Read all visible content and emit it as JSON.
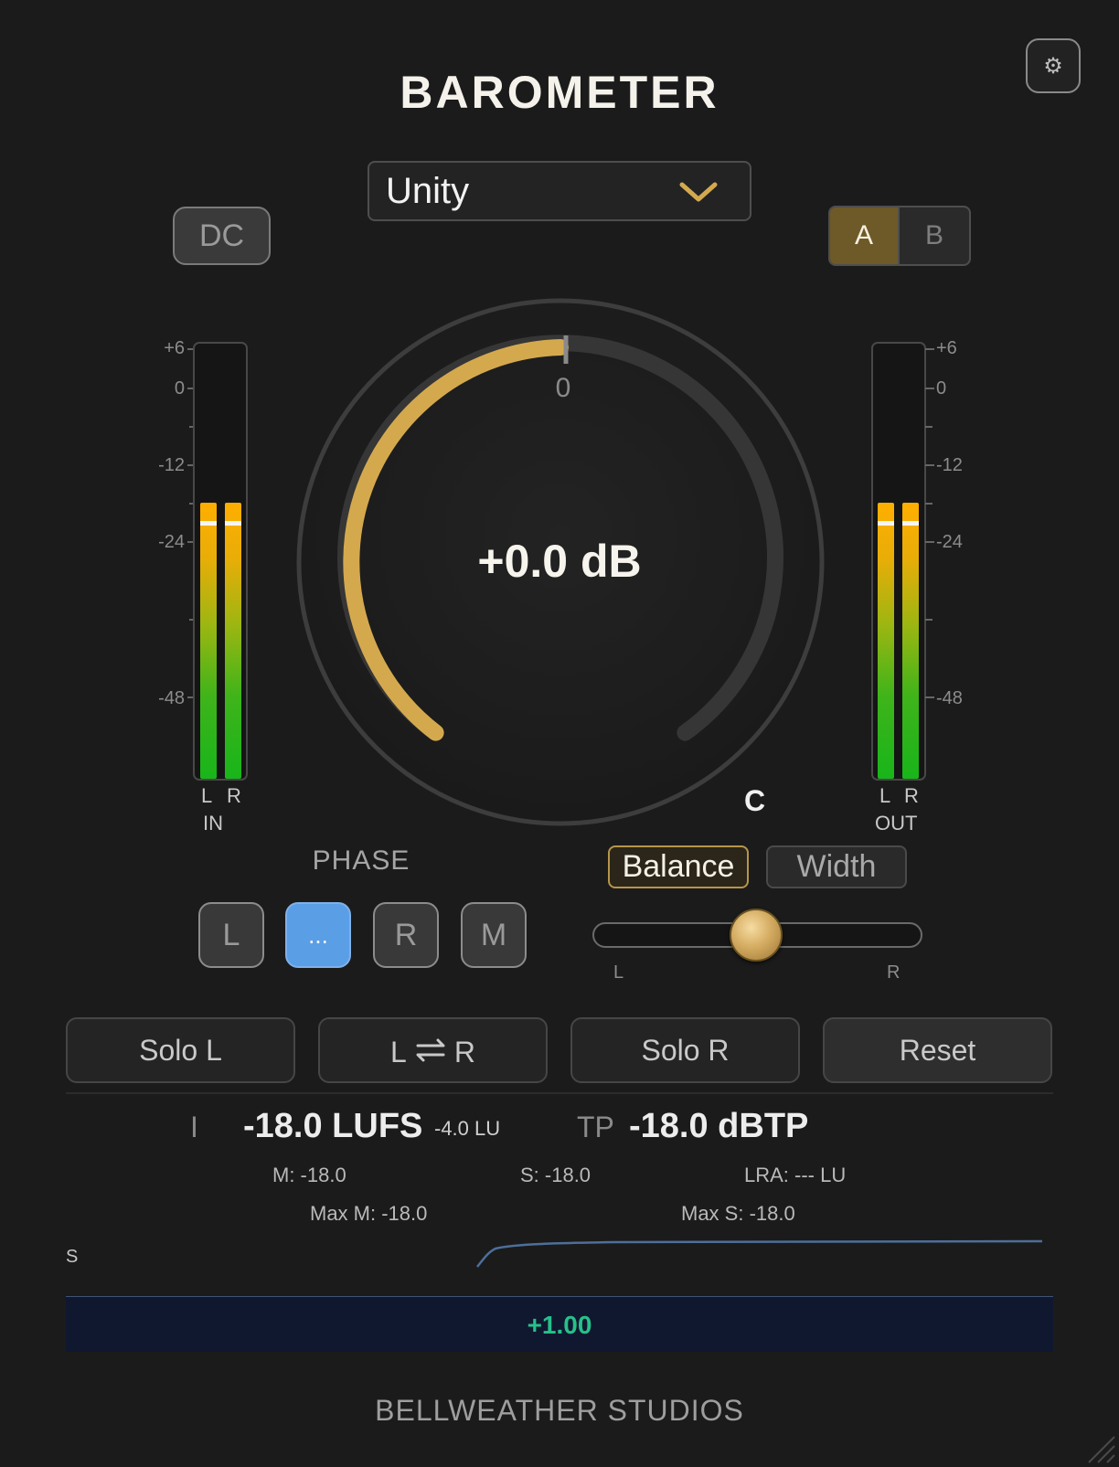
{
  "app": {
    "title": "BAROMETER",
    "brand": "BELLWEATHER STUDIOS"
  },
  "header": {
    "settings_icon": "gear-icon",
    "preset": {
      "selected": "Unity",
      "chevron_icon": "chevron-down-icon"
    },
    "dc_label": "DC",
    "ab": {
      "a_label": "A",
      "b_label": "B",
      "active": "A"
    }
  },
  "meters": {
    "input": {
      "label": "IN",
      "channels": [
        "L",
        "R"
      ],
      "scale": [
        "+6",
        "0",
        "-12",
        "-24",
        "-48"
      ],
      "level_db": -18,
      "peak_db": -18
    },
    "output": {
      "label": "OUT",
      "channels": [
        "L",
        "R"
      ],
      "scale": [
        "+6",
        "0",
        "-12",
        "-24",
        "-48"
      ],
      "level_db": -18,
      "peak_db": -18
    }
  },
  "knob": {
    "value_text": "+0.0 dB",
    "zero_label": "0",
    "value_db": 0
  },
  "phase": {
    "label": "PHASE",
    "buttons": [
      "L",
      "...",
      "R",
      "M"
    ],
    "active_index": 1
  },
  "stereo": {
    "center_label": "C",
    "mode_balance": "Balance",
    "mode_width": "Width",
    "active_mode": "Balance",
    "slider_left": "L",
    "slider_right": "R",
    "slider_value": 0.5
  },
  "actions": {
    "solo_l": "Solo L",
    "swap_left": "L",
    "swap_icon": "swap-arrows-icon",
    "swap_right": "R",
    "solo_r": "Solo R",
    "reset": "Reset"
  },
  "loudness": {
    "integrated_key": "I",
    "integrated_value": "-18.0 LUFS",
    "integrated_delta": "-4.0 LU",
    "tp_key": "TP",
    "tp_value": "-18.0 dBTP",
    "momentary": "M: -18.0",
    "short_term": "S: -18.0",
    "lra": "LRA: --- LU",
    "max_momentary": "Max M: -18.0",
    "max_short": "Max S: -18.0"
  },
  "graph": {
    "label": "S",
    "correlation": "+1.00"
  },
  "colors": {
    "accent_gold": "#d4a94e",
    "phase_active_blue": "#5a9ee6",
    "correlation_green": "#27c08a",
    "meter_green": "#18b51a",
    "meter_orange": "#ffae00"
  }
}
